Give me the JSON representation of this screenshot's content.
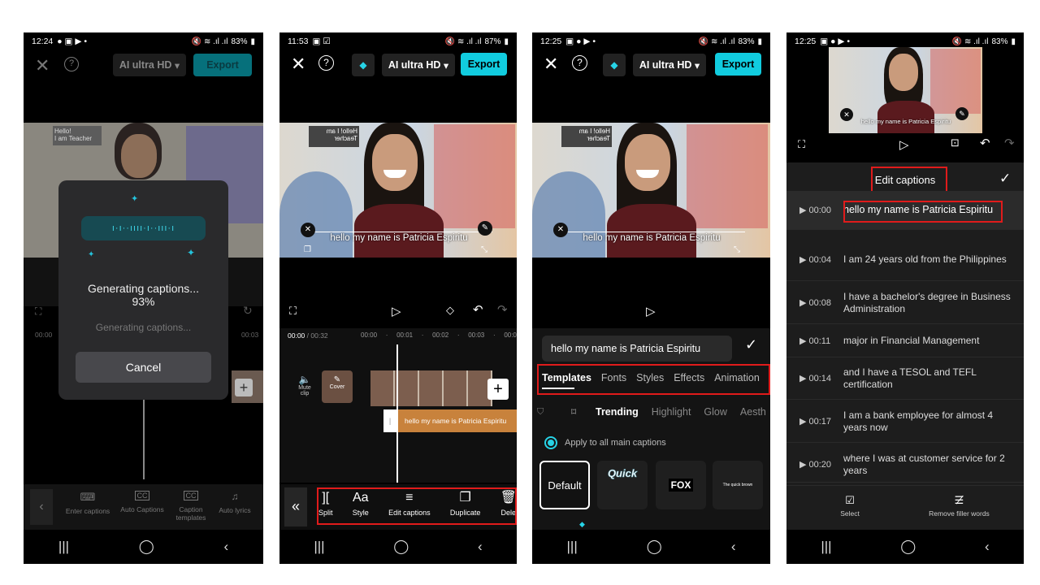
{
  "panel1": {
    "status": {
      "time": "12:24",
      "battery": "83%"
    },
    "quality": "AI ultra HD",
    "export": "Export",
    "dialog": {
      "title": "Generating captions...",
      "percent": "93%",
      "sub": "Generating captions...",
      "cancel": "Cancel"
    },
    "timeline": {
      "start": "00:00",
      "end": "00:03"
    },
    "tools": [
      {
        "label": "Enter captions",
        "icon": "⌨"
      },
      {
        "label": "Auto Captions",
        "icon": "CC"
      },
      {
        "label": "Caption templates",
        "icon": "CC"
      },
      {
        "label": "Auto lyrics",
        "icon": "♫"
      }
    ],
    "poster": {
      "line1": "Hello!",
      "line2": "I am Teacher"
    }
  },
  "panel2": {
    "status": {
      "time": "11:53",
      "battery": "87%"
    },
    "quality": "AI ultra HD",
    "export": "Export",
    "caption": "hello my name is Patricia Espiritu",
    "time_current": "00:00",
    "time_total": "/ 00:32",
    "ruler": [
      "00:00",
      "00:01",
      "00:02",
      "00:03",
      "00:0"
    ],
    "mute": "Mute clip",
    "cover": "Cover",
    "track_caption": "hello my name is Patricia Espiritu",
    "tools": [
      {
        "label": "Split",
        "icon": "]["
      },
      {
        "label": "Style",
        "icon": "Aa"
      },
      {
        "label": "Edit captions",
        "icon": "≡"
      },
      {
        "label": "Duplicate",
        "icon": "❐"
      },
      {
        "label": "Dele",
        "icon": "🗑"
      }
    ]
  },
  "panel3": {
    "status": {
      "time": "12:25",
      "battery": "83%"
    },
    "quality": "AI ultra HD",
    "export": "Export",
    "caption": "hello my name is Patricia Espiritu",
    "input_value": "hello my name is Patricia Espiritu",
    "tabs": [
      "Templates",
      "Fonts",
      "Styles",
      "Effects",
      "Animation"
    ],
    "subtabs": [
      "Trending",
      "Highlight",
      "Glow",
      "Aesth"
    ],
    "apply_all": "Apply to all main captions",
    "templates": [
      "Default",
      "Quick",
      "FOX",
      "The quick brown"
    ]
  },
  "panel4": {
    "status": {
      "time": "12:25",
      "battery": "83%"
    },
    "title": "Edit captions",
    "mini_caption": "hello my name is Patricia Espiritu",
    "captions": [
      {
        "time": "00:00",
        "text": "hello my name is Patricia Espiritu"
      },
      {
        "time": "00:04",
        "text": "I am 24 years old from the Philippines"
      },
      {
        "time": "00:08",
        "text": "I have a bachelor's degree in Business Administration"
      },
      {
        "time": "00:11",
        "text": "major in Financial Management"
      },
      {
        "time": "00:14",
        "text": "and I have a TESOL and TEFL certification"
      },
      {
        "time": "00:17",
        "text": "I am a bank employee for almost 4 years now"
      },
      {
        "time": "00:20",
        "text": "where I was at customer service for 2 years"
      }
    ],
    "select": "Select",
    "remove_filler": "Remove filler words"
  },
  "colors": {
    "accent": "#00c9e0",
    "red": "#e01b1b",
    "track": "#c8823c"
  }
}
